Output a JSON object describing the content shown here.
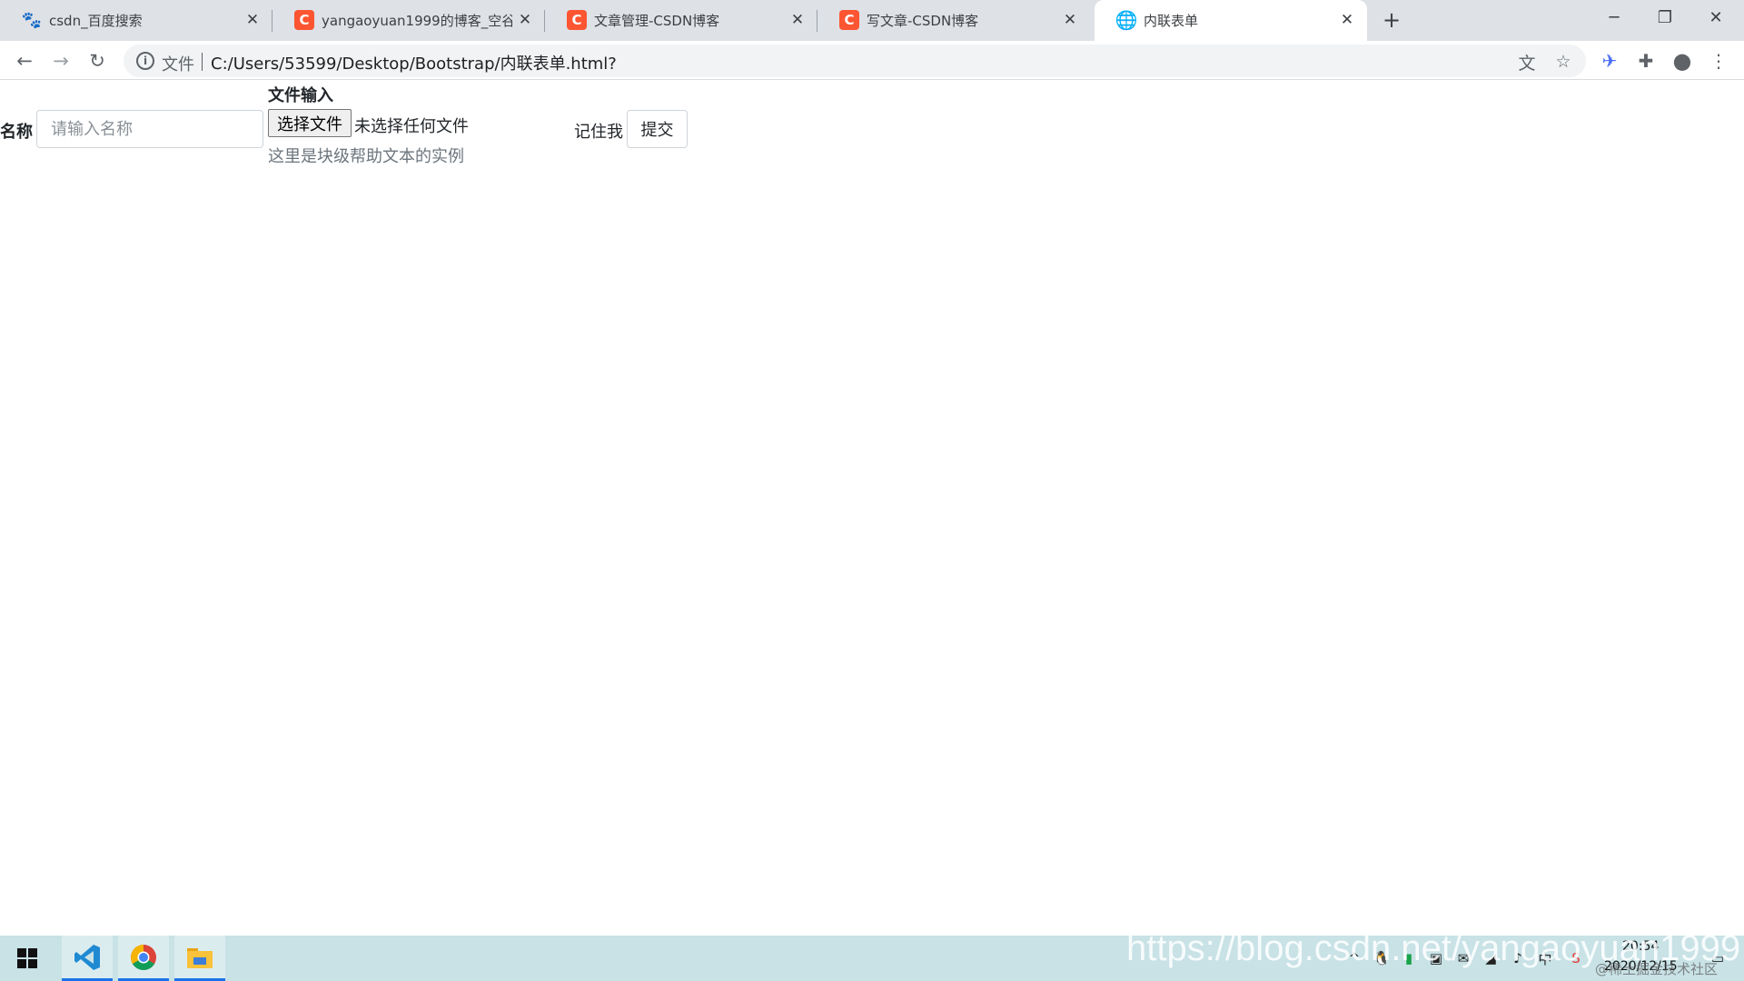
{
  "browser": {
    "tabs": [
      {
        "title": "csdn_百度搜索",
        "favicon": "baidu-paw-icon",
        "active": false
      },
      {
        "title": "yangaoyuan1999的博客_空谷",
        "favicon": "csdn-icon",
        "active": false
      },
      {
        "title": "文章管理-CSDN博客",
        "favicon": "csdn-icon",
        "active": false
      },
      {
        "title": "写文章-CSDN博客",
        "favicon": "csdn-icon",
        "active": false
      },
      {
        "title": "内联表单",
        "favicon": "globe-icon",
        "active": true
      }
    ],
    "address": {
      "scheme_label": "文件",
      "url": "C:/Users/53599/Desktop/Bootstrap/内联表单.html?"
    },
    "colors": {
      "tabstrip": "#dee1e6",
      "csdn": "#fc5531",
      "accent": "#1a73e8"
    }
  },
  "form": {
    "name_label": "名称",
    "name_placeholder": "请输入名称",
    "file_label": "文件输入",
    "file_button": "选择文件",
    "file_status": "未选择任何文件",
    "help_text": "这里是块级帮助文本的实例",
    "remember_label": "记住我",
    "submit_label": "提交"
  },
  "taskbar": {
    "time": "20:54",
    "date": "2020/12/15",
    "watermark": "https://blog.csdn.net/yangaoyuan1999",
    "watermark_small": "@稀土掘金技术社区"
  }
}
